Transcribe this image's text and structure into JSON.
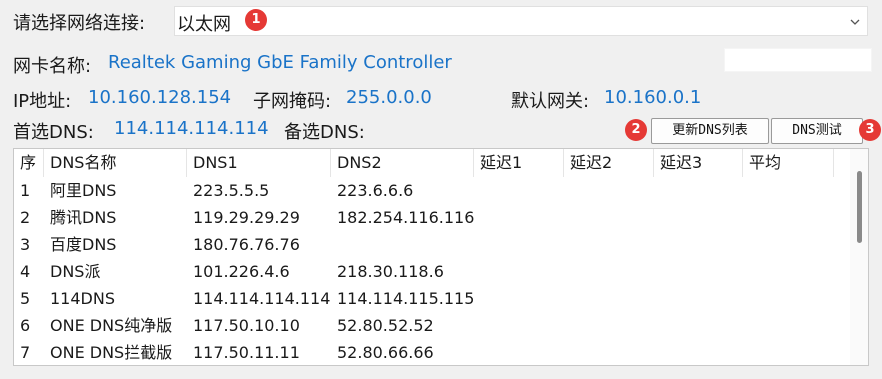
{
  "network": {
    "label": "请选择网络连接:",
    "selected": "以太网",
    "badge": "1"
  },
  "adapter": {
    "label": "网卡名称:",
    "value": "Realtek Gaming GbE Family Controller"
  },
  "ip": {
    "ip_label": "IP地址:",
    "ip_value": "10.160.128.154",
    "mask_label": "子网掩码:",
    "mask_value": "255.0.0.0",
    "gateway_label": "默认网关:",
    "gateway_value": "10.160.0.1"
  },
  "dns": {
    "primary_label": "首选DNS:",
    "primary_value": "114.114.114.114",
    "secondary_label": "备选DNS:"
  },
  "buttons": {
    "update_label": "更新DNS列表",
    "update_badge": "2",
    "test_label": "DNS测试",
    "test_badge": "3"
  },
  "table": {
    "headers": [
      "序",
      "DNS名称",
      "DNS1",
      "DNS2",
      "延迟1",
      "延迟2",
      "延迟3",
      "平均"
    ],
    "rows": [
      [
        "1",
        "阿里DNS",
        "223.5.5.5",
        "223.6.6.6"
      ],
      [
        "2",
        "腾讯DNS",
        "119.29.29.29",
        "182.254.116.116"
      ],
      [
        "3",
        "百度DNS",
        "180.76.76.76",
        ""
      ],
      [
        "4",
        "DNS派",
        "101.226.4.6",
        "218.30.118.6"
      ],
      [
        "5",
        "114DNS",
        "114.114.114.114",
        "114.114.115.115"
      ],
      [
        "6",
        "ONE DNS纯净版",
        "117.50.10.10",
        "52.80.52.52"
      ],
      [
        "7",
        "ONE DNS拦截版",
        "117.50.11.11",
        "52.80.66.66"
      ]
    ]
  },
  "colors": {
    "value_blue": "#1a73c8",
    "badge_red": "#e53935"
  }
}
